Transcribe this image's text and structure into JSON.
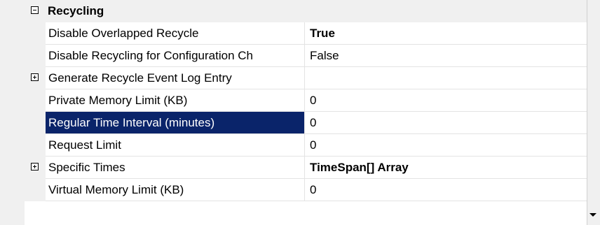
{
  "category": {
    "label": "Recycling",
    "expanded": true
  },
  "rows": [
    {
      "name": "Disable Overlapped Recycle",
      "value": "True",
      "bold": true,
      "expander": "",
      "selected": false
    },
    {
      "name": "Disable Recycling for Configuration Ch",
      "value": "False",
      "bold": false,
      "expander": "",
      "selected": false
    },
    {
      "name": "Generate Recycle Event Log Entry",
      "value": "",
      "bold": false,
      "expander": "plus",
      "selected": false
    },
    {
      "name": "Private Memory Limit (KB)",
      "value": "0",
      "bold": false,
      "expander": "",
      "selected": false
    },
    {
      "name": "Regular Time Interval (minutes)",
      "value": "0",
      "bold": false,
      "expander": "",
      "selected": true
    },
    {
      "name": "Request Limit",
      "value": "0",
      "bold": false,
      "expander": "",
      "selected": false
    },
    {
      "name": "Specific Times",
      "value": "TimeSpan[] Array",
      "bold": true,
      "expander": "plus",
      "selected": false
    },
    {
      "name": "Virtual Memory Limit (KB)",
      "value": "0",
      "bold": false,
      "expander": "",
      "selected": false
    }
  ],
  "colors": {
    "selection": "#0a246a",
    "gridline": "#e3e3e3",
    "background": "#f0f0f0"
  },
  "icons": {
    "collapse": "minus-box-icon",
    "expand": "plus-box-icon",
    "scroll_down": "scroll-down-arrow-icon"
  }
}
